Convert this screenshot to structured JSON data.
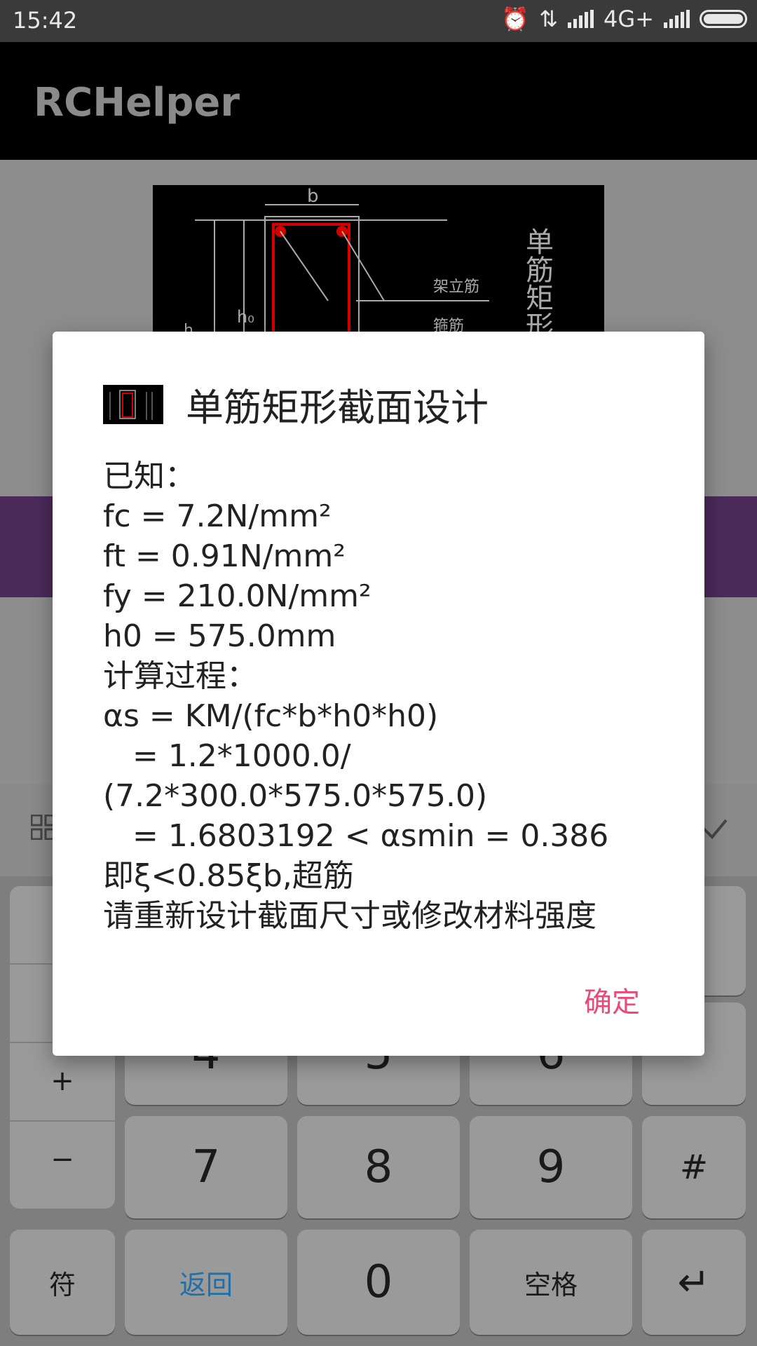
{
  "status_bar": {
    "time": "15:42",
    "network": "4G+"
  },
  "app_bar": {
    "title": "RCHelper"
  },
  "diagram": {
    "label_b": "b",
    "label_h0": "h₀",
    "label_h": "h",
    "label_erect_rebar": "架立筋",
    "label_stirrup": "箍筋",
    "vertical_title": "单筋矩形截"
  },
  "dialog": {
    "title": "单筋矩形截面设计",
    "lines": [
      "已知：",
      "fc = 7.2N/mm²",
      "ft = 0.91N/mm²",
      "fy = 210.0N/mm²",
      "h0 = 575.0mm",
      "计算过程：",
      "αs = KM/(fc*b*h0*h0)",
      "   = 1.2*1000.0/",
      "(7.2*300.0*575.0*575.0)",
      "   = 1.6803192 < αsmin = 0.386",
      "即ξ<0.85ξb,超筋",
      "请重新设计截面尺寸或修改材料强度"
    ],
    "ok_label": "确定"
  },
  "keyboard": {
    "side_keys": [
      "+",
      "−"
    ],
    "rows": [
      [
        "4",
        "5",
        "6",
        "*"
      ],
      [
        "7",
        "8",
        "9",
        "#"
      ]
    ],
    "bottom": {
      "symbol": "符",
      "back": "返回",
      "zero": "0",
      "space": "空格",
      "enter": "↵"
    }
  },
  "colors": {
    "accent": "#e84a7a",
    "back_key": "#1f6fa8",
    "band": "#4b2a5a"
  }
}
